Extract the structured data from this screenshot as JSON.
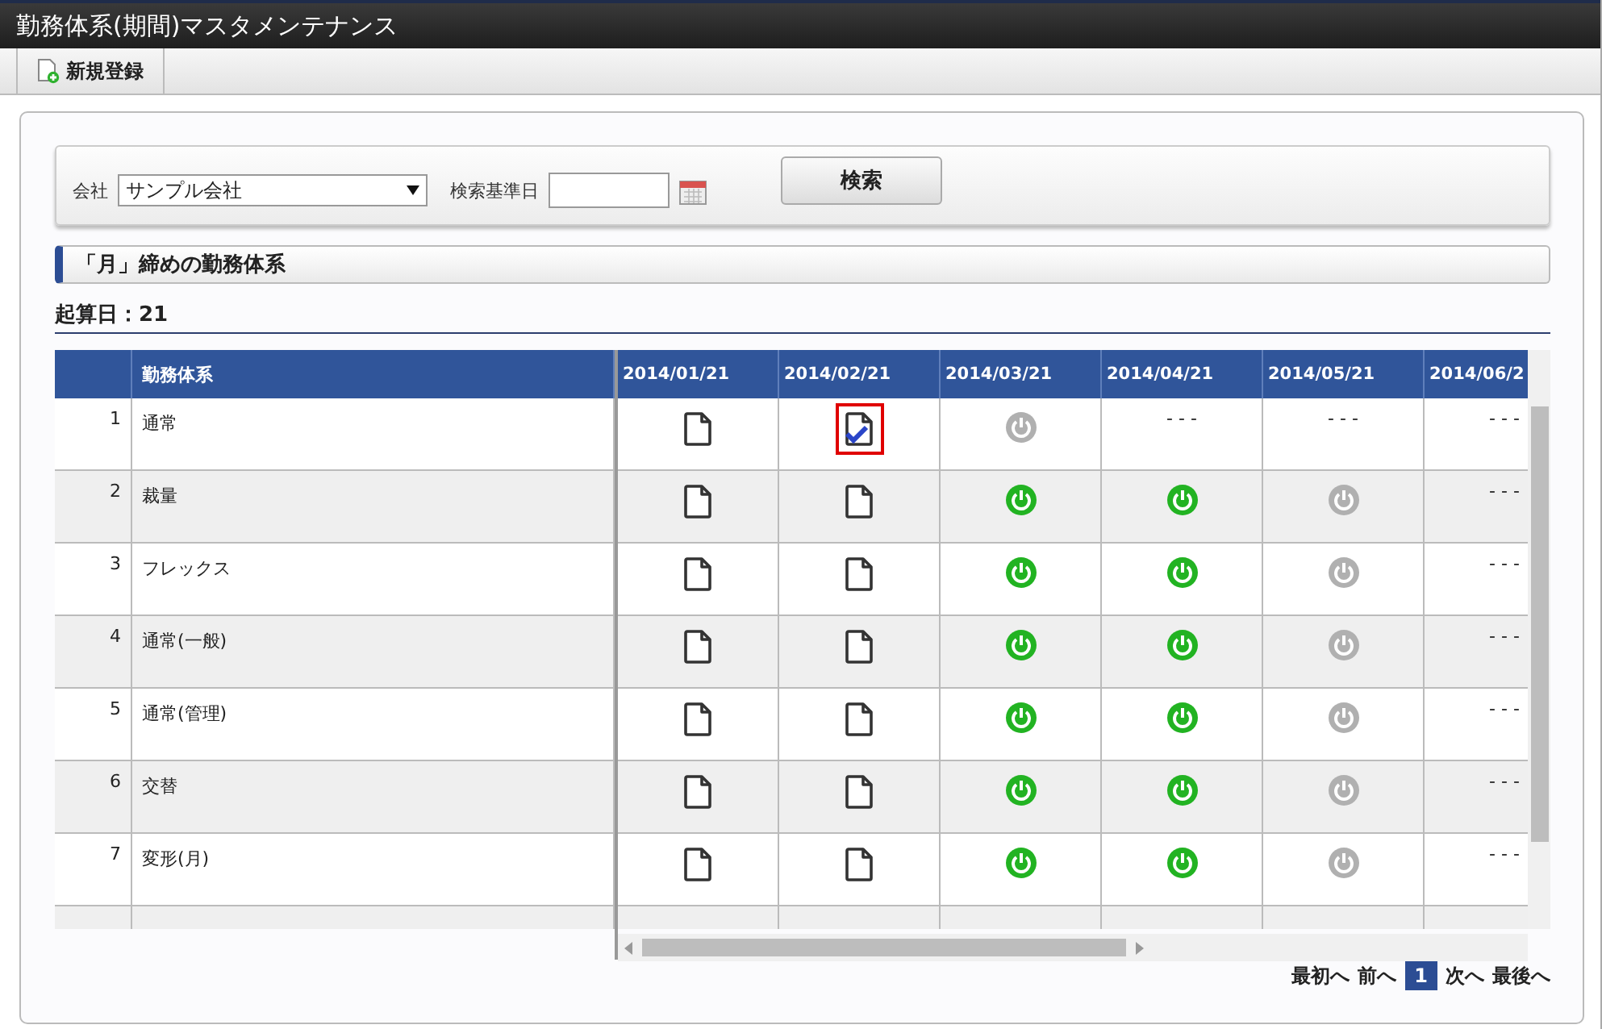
{
  "window": {
    "title": "勤務体系(期間)マスタメンテナンス"
  },
  "toolbar": {
    "new_button": "新規登録"
  },
  "search": {
    "company_label": "会社",
    "company_value": "サンプル会社",
    "date_label": "検索基準日",
    "search_button": "検索"
  },
  "section": {
    "title": "「月」締めの勤務体系"
  },
  "start_day": "起算日：21",
  "table": {
    "columns": [
      "",
      "勤務体系",
      "2014/01/21",
      "2014/02/21",
      "2014/03/21",
      "2014/04/21",
      "2014/05/21",
      "2014/06/2"
    ],
    "rows": [
      {
        "cells": [
          {
            "kind": "number",
            "text": "1"
          },
          {
            "kind": "text",
            "text": "通常"
          },
          {
            "kind": "doc"
          },
          {
            "kind": "doc-check"
          },
          {
            "kind": "power-off"
          },
          {
            "kind": "dash",
            "text": "- - -"
          },
          {
            "kind": "dash",
            "text": "- - -"
          },
          {
            "kind": "dash",
            "text": "- - -"
          }
        ]
      },
      {
        "cells": [
          {
            "kind": "number",
            "text": "2"
          },
          {
            "kind": "text",
            "text": "裁量"
          },
          {
            "kind": "doc"
          },
          {
            "kind": "doc"
          },
          {
            "kind": "power-on"
          },
          {
            "kind": "power-on"
          },
          {
            "kind": "power-off"
          },
          {
            "kind": "dash",
            "text": "- - -"
          }
        ]
      },
      {
        "cells": [
          {
            "kind": "number",
            "text": "3"
          },
          {
            "kind": "text",
            "text": "フレックス"
          },
          {
            "kind": "doc"
          },
          {
            "kind": "doc"
          },
          {
            "kind": "power-on"
          },
          {
            "kind": "power-on"
          },
          {
            "kind": "power-off"
          },
          {
            "kind": "dash",
            "text": "- - -"
          }
        ]
      },
      {
        "cells": [
          {
            "kind": "number",
            "text": "4"
          },
          {
            "kind": "text",
            "text": "通常(一般)"
          },
          {
            "kind": "doc"
          },
          {
            "kind": "doc"
          },
          {
            "kind": "power-on"
          },
          {
            "kind": "power-on"
          },
          {
            "kind": "power-off"
          },
          {
            "kind": "dash",
            "text": "- - -"
          }
        ]
      },
      {
        "cells": [
          {
            "kind": "number",
            "text": "5"
          },
          {
            "kind": "text",
            "text": "通常(管理)"
          },
          {
            "kind": "doc"
          },
          {
            "kind": "doc"
          },
          {
            "kind": "power-on"
          },
          {
            "kind": "power-on"
          },
          {
            "kind": "power-off"
          },
          {
            "kind": "dash",
            "text": "- - -"
          }
        ]
      },
      {
        "cells": [
          {
            "kind": "number",
            "text": "6"
          },
          {
            "kind": "text",
            "text": "交替"
          },
          {
            "kind": "doc"
          },
          {
            "kind": "doc"
          },
          {
            "kind": "power-on"
          },
          {
            "kind": "power-on"
          },
          {
            "kind": "power-off"
          },
          {
            "kind": "dash",
            "text": "- - -"
          }
        ]
      },
      {
        "cells": [
          {
            "kind": "number",
            "text": "7"
          },
          {
            "kind": "text",
            "text": "変形(月)"
          },
          {
            "kind": "doc"
          },
          {
            "kind": "doc"
          },
          {
            "kind": "power-on"
          },
          {
            "kind": "power-on"
          },
          {
            "kind": "power-off"
          },
          {
            "kind": "dash",
            "text": "- - -"
          }
        ]
      }
    ]
  },
  "pagination": {
    "first": "最初へ",
    "prev": "前へ",
    "pages": [
      {
        "label": "1",
        "selected": true
      }
    ],
    "next": "次へ",
    "last": "最後へ"
  }
}
